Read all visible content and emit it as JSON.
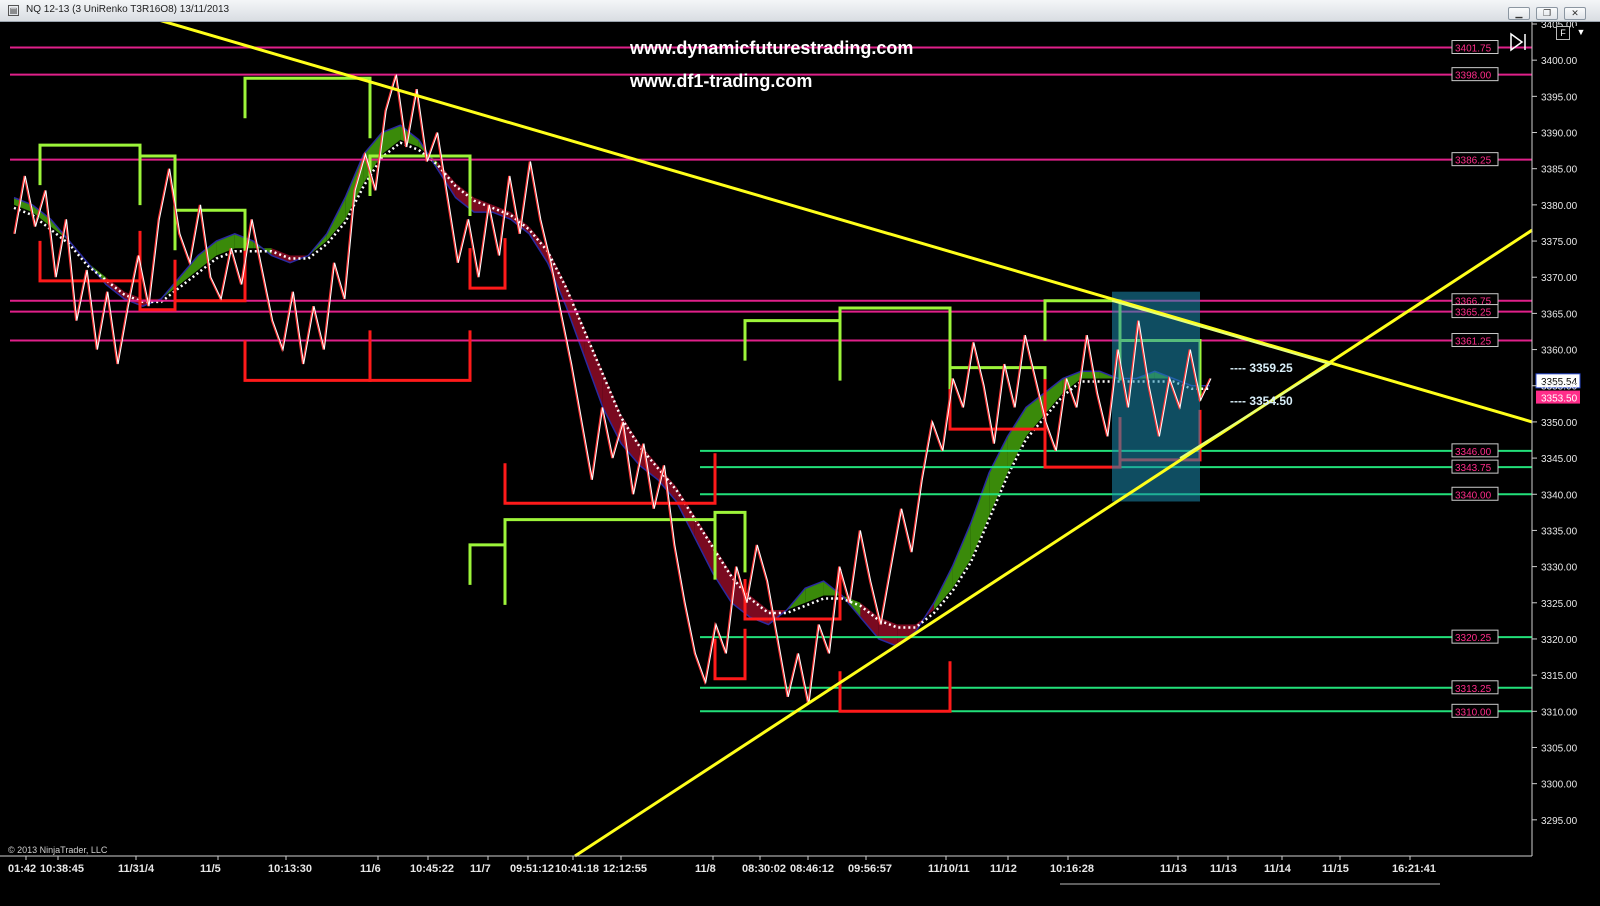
{
  "window": {
    "title": "NQ 12-13 (3 UniRenko T3R16O8)  13/11/2013",
    "min_icon": "minimize-icon",
    "max_icon": "restore-icon",
    "close_icon": "close-icon"
  },
  "overlay": {
    "url1": "www.dynamicfuturestrading.com",
    "url2": "www.df1-trading.com",
    "copyright": "© 2013 NinjaTrader, LLC",
    "target_upper": "---- 3359.25",
    "target_lower": "---- 3354.50",
    "f_button": "F"
  },
  "chart_data": {
    "type": "line",
    "instrument": "NQ 12-13",
    "ylim": [
      3290,
      3405
    ],
    "y_ticks": [
      3295,
      3300,
      3305,
      3310,
      3315,
      3320,
      3325,
      3330,
      3335,
      3340,
      3345,
      3350,
      3355,
      3360,
      3365,
      3370,
      3375,
      3380,
      3385,
      3390,
      3395,
      3400,
      3405
    ],
    "x_tick_labels": [
      "01:42",
      "10:38:45",
      "11/31/4",
      "11/5",
      "10:13:30",
      "11/6",
      "10:45:22",
      "11/7",
      "09:51:12",
      "10:41:18",
      "12:12:55",
      "11/8",
      "08:30:02",
      "08:46:12",
      "09:56:57",
      "11/10/11",
      "11/12",
      "10:16:28",
      "11/13",
      "11/13",
      "11/14",
      "11/15",
      "16:21:41"
    ],
    "last_price": 3355.54,
    "bid_tag": 3353.5,
    "levels": [
      {
        "value": 3401.75,
        "color": "#e0208a"
      },
      {
        "value": 3398.0,
        "color": "#e0208a"
      },
      {
        "value": 3386.25,
        "color": "#e0208a"
      },
      {
        "value": 3366.75,
        "color": "#e0208a"
      },
      {
        "value": 3365.25,
        "color": "#e0208a"
      },
      {
        "value": 3361.25,
        "color": "#e0208a"
      },
      {
        "value": 3346.0,
        "color": "#22e07a"
      },
      {
        "value": 3343.75,
        "color": "#22e07a"
      },
      {
        "value": 3340.0,
        "color": "#22e07a"
      },
      {
        "value": 3320.25,
        "color": "#22e07a"
      },
      {
        "value": 3313.25,
        "color": "#22e07a"
      },
      {
        "value": 3310.0,
        "color": "#22e07a"
      }
    ],
    "price_series": [
      3376,
      3384,
      3377,
      3382,
      3370,
      3378,
      3364,
      3371,
      3360,
      3368,
      3358,
      3366,
      3373,
      3366,
      3378,
      3385,
      3376,
      3372,
      3380,
      3370,
      3367,
      3374,
      3369,
      3378,
      3371,
      3364,
      3360,
      3368,
      3358,
      3366,
      3360,
      3372,
      3367,
      3382,
      3387,
      3382,
      3393,
      3398,
      3388,
      3396,
      3386,
      3390,
      3381,
      3372,
      3378,
      3370,
      3380,
      3373,
      3384,
      3376,
      3386,
      3378,
      3372,
      3365,
      3358,
      3350,
      3342,
      3352,
      3345,
      3350,
      3340,
      3347,
      3338,
      3344,
      3333,
      3325,
      3318,
      3314,
      3322,
      3318,
      3330,
      3325,
      3333,
      3328,
      3320,
      3312,
      3318,
      3311,
      3322,
      3318,
      3330,
      3325,
      3335,
      3328,
      3322,
      3330,
      3338,
      3332,
      3342,
      3350,
      3346,
      3356,
      3352,
      3361,
      3355,
      3347,
      3358,
      3352,
      3362,
      3356,
      3350,
      3346,
      3356,
      3352,
      3362,
      3354,
      3348,
      3360,
      3352,
      3364,
      3355,
      3348,
      3356,
      3352,
      3360,
      3353,
      3356
    ],
    "band_fast": [
      3381,
      3380,
      3378,
      3375,
      3372,
      3369,
      3367,
      3366,
      3367,
      3370,
      3373,
      3375,
      3376,
      3375,
      3373,
      3372,
      3373,
      3376,
      3381,
      3387,
      3390,
      3391,
      3389,
      3385,
      3381,
      3379,
      3379,
      3378,
      3376,
      3372,
      3366,
      3359,
      3352,
      3347,
      3344,
      3342,
      3339,
      3334,
      3329,
      3325,
      3323,
      3322,
      3324,
      3327,
      3328,
      3326,
      3323,
      3320,
      3319,
      3321,
      3325,
      3330,
      3336,
      3343,
      3348,
      3352,
      3354,
      3356,
      3357,
      3357,
      3356,
      3356,
      3357,
      3356,
      3355,
      3355
    ],
    "band_slow": [
      3380,
      3379,
      3377,
      3375,
      3372,
      3370,
      3368,
      3367,
      3367,
      3369,
      3371,
      3373,
      3374,
      3374,
      3374,
      3373,
      3373,
      3375,
      3378,
      3383,
      3387,
      3389,
      3388,
      3386,
      3383,
      3381,
      3380,
      3379,
      3377,
      3374,
      3369,
      3363,
      3357,
      3351,
      3347,
      3344,
      3341,
      3337,
      3333,
      3329,
      3326,
      3324,
      3324,
      3325,
      3326,
      3326,
      3325,
      3323,
      3322,
      3322,
      3324,
      3327,
      3331,
      3337,
      3343,
      3348,
      3351,
      3354,
      3356,
      3356,
      3356,
      3356,
      3356,
      3356,
      3355,
      3355
    ],
    "trendlines": [
      {
        "name": "down-trendline",
        "from": [
          "01:42",
          3405.5
        ],
        "to": [
          "16:21:41",
          3350
        ]
      },
      {
        "name": "up-trendline",
        "from": [
          "10:41:18",
          3250
        ],
        "to": [
          "16:21:41",
          3376.5
        ]
      }
    ],
    "swing_boxes_high": [
      3388.25,
      3386.75,
      3379.25,
      3397.5,
      3386.75,
      3333,
      3336.5,
      3337.5,
      3364,
      3365.75,
      3357.5,
      3366.75,
      3361.25
    ],
    "swing_boxes_low": [
      3369.5,
      3365.5,
      3366.75,
      3355.75,
      3355.75,
      3368.5,
      3338.75,
      3314.5,
      3322.75,
      3310,
      3349,
      3343.75,
      3344.75
    ]
  }
}
